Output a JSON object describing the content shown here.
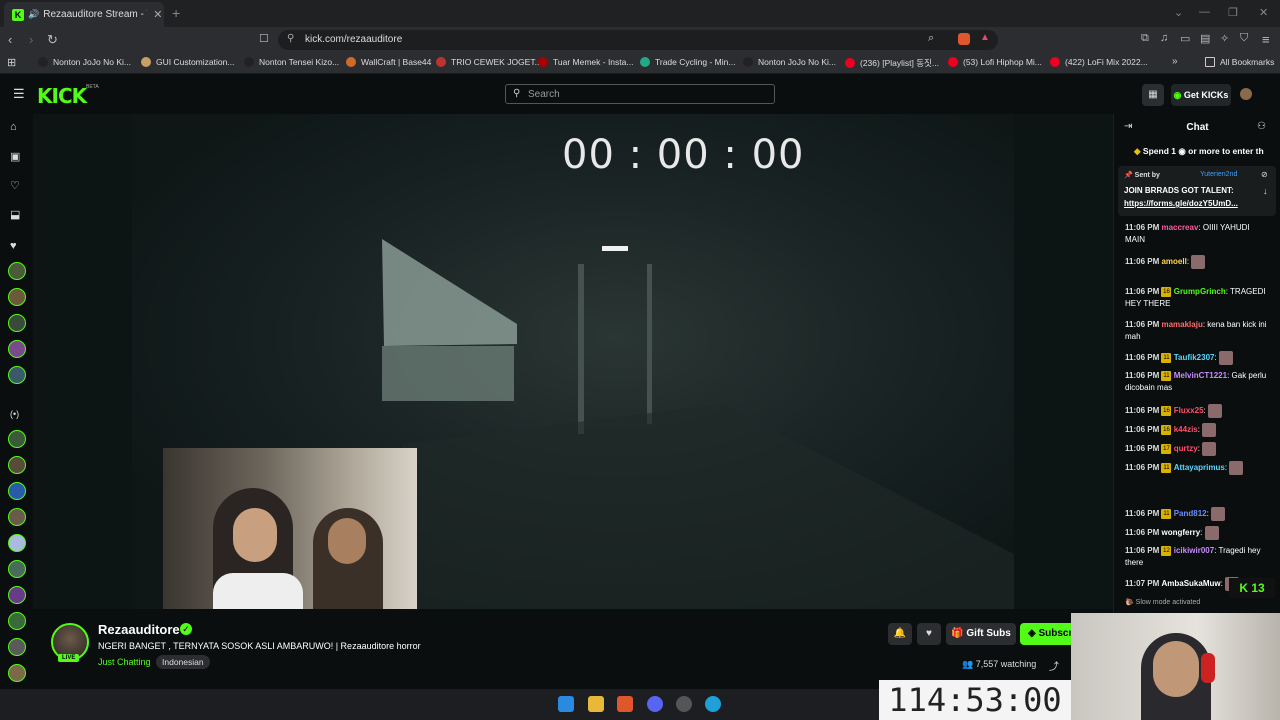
{
  "browser": {
    "tab_title": "Rezaauditore Stream - Watch",
    "url": "kick.com/rezaauditore",
    "bookmarks": [
      "Nonton JoJo No Ki...",
      "GUI Customization...",
      "Nonton Tensei Kizo...",
      "WallCraft | Base44",
      "TRIO CEWEK JOGET...",
      "Tuar Memek - Insta...",
      "Trade Cycling - Min...",
      "Nonton JoJo No Ki...",
      "(236) [Playlist] 동짓...",
      "(53) Lofi Hiphop Mi...",
      "(422) LoFi Mix 2022...",
      "All Bookmarks"
    ]
  },
  "header": {
    "logo": "KICK",
    "beta": "BETA",
    "search_placeholder": "Search",
    "get_kicks": "Get KICKs"
  },
  "video": {
    "timer": "00 : 00 : 00"
  },
  "stream": {
    "streamer": "Rezaauditore",
    "live": "LIVE",
    "title": "NGERI BANGET , TERNYATA SOSOK ASLI AMBARUWO! | Rezaauditore horror",
    "category": "Just Chatting",
    "language": "Indonesian",
    "gift_subs": "Gift Subs",
    "subscribe": "Subscribe",
    "viewers": "7,557 watching"
  },
  "chat": {
    "title": "Chat",
    "spend_notice": "Spend 1 ◉ or more to enter th",
    "pinned_sent_by": "Sent by",
    "pinned_user": "Yuterien2nd",
    "pinned_msg": "JOIN BRRADS GOT TALENT:",
    "pinned_link": "https://forms.gle/dozY5UmD...",
    "slow_mode": "Slow mode activated",
    "kick_count": "13",
    "messages": [
      {
        "time": "11:06 PM",
        "user": "maccreav",
        "color": "#ff5aa5",
        "badge": "",
        "text": "OIIII YAHUDI MAIN"
      },
      {
        "time": "11:06 PM",
        "user": "amoell",
        "color": "#ffd75a",
        "badge": "",
        "text": ""
      },
      {
        "time": "11:06 PM",
        "user": "GrumpGrinch",
        "color": "#53fc18",
        "badge": "16",
        "text": "TRAGEDI HEY THERE"
      },
      {
        "time": "11:06 PM",
        "user": "mamaklaju",
        "color": "#ff6b6b",
        "badge": "",
        "text": "kena ban kick ini mah"
      },
      {
        "time": "11:06 PM",
        "user": "Taufik2307",
        "color": "#5ad7ff",
        "badge": "11",
        "text": ""
      },
      {
        "time": "11:06 PM",
        "user": "MelvinCT1221",
        "color": "#c78bff",
        "badge": "11",
        "text": "Gak perlu dicobain mas"
      },
      {
        "time": "11:06 PM",
        "user": "Fluxx25",
        "color": "#ff4d6d",
        "badge": "16",
        "text": ""
      },
      {
        "time": "11:06 PM",
        "user": "k44zis",
        "color": "#ff4d6d",
        "badge": "16",
        "text": ""
      },
      {
        "time": "11:06 PM",
        "user": "qurtzy",
        "color": "#ff4d6d",
        "badge": "17",
        "text": ""
      },
      {
        "time": "11:06 PM",
        "user": "Attayaprimus",
        "color": "#5ad7ff",
        "badge": "11",
        "text": ""
      },
      {
        "time": "11:06 PM",
        "user": "Pand812",
        "color": "#6b8cff",
        "badge": "11",
        "text": ""
      },
      {
        "time": "11:06 PM",
        "user": "wongferry",
        "color": "#ffffff",
        "badge": "",
        "text": ""
      },
      {
        "time": "11:06 PM",
        "user": "icikiwir007",
        "color": "#c78bff",
        "badge": "12",
        "text": "Tragedi hey there"
      },
      {
        "time": "11:07 PM",
        "user": "AmbaSukaMuw",
        "color": "#ffffff",
        "badge": "",
        "text": ""
      }
    ]
  },
  "overlay": {
    "big_timer": "114:53:00"
  },
  "colors": {
    "accent": "#53fc18",
    "bg": "#0b0e0f"
  }
}
